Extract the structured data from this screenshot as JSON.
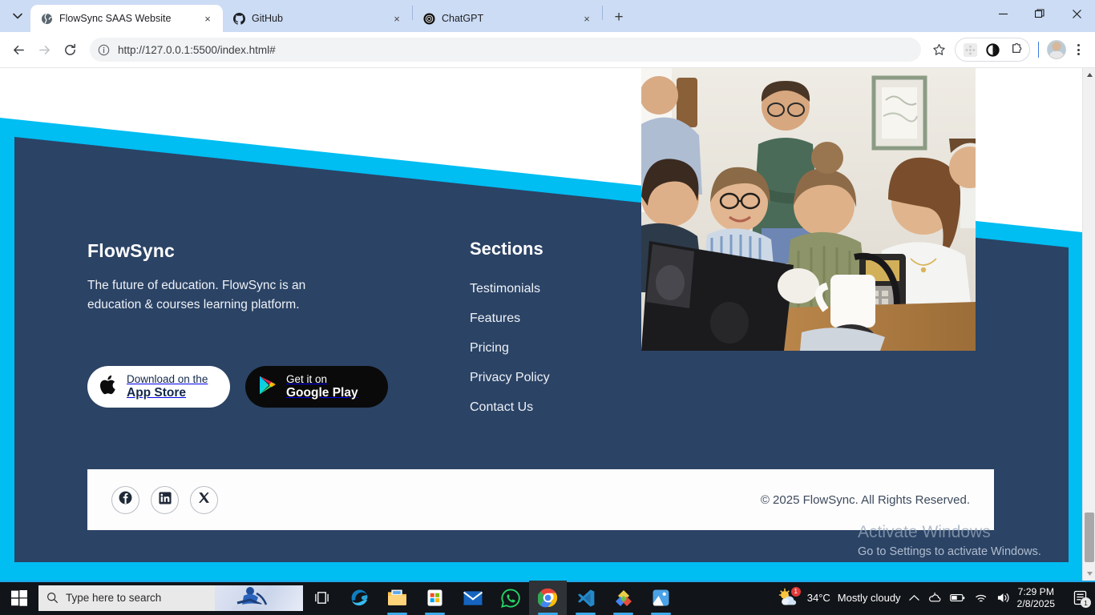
{
  "browser": {
    "tabs": [
      {
        "title": "FlowSync SAAS Website",
        "favicon": "globe-icon",
        "active": true,
        "close": "×"
      },
      {
        "title": "GitHub",
        "favicon": "github-icon",
        "active": false,
        "close": "×"
      },
      {
        "title": "ChatGPT",
        "favicon": "openai-icon",
        "active": false,
        "close": "×"
      }
    ],
    "new_tab_label": "+",
    "window_controls": {
      "minimize": "—",
      "maximize": "❐",
      "close": "✕"
    },
    "toolbar": {
      "back": "←",
      "forward": "→",
      "reload": "↻",
      "url": "http://127.0.0.1:5500/index.html#",
      "site_info": "info-icon",
      "bookmark": "star-icon",
      "extensions": "puzzle-icon",
      "profile": "avatar",
      "menu": "kebab-menu-icon"
    }
  },
  "page": {
    "brand": "FlowSync",
    "tagline": "The future of education. FlowSync is an education & courses learning platform.",
    "store_buttons": [
      {
        "id": "app-store",
        "icon": "apple-icon",
        "top": "Download on the",
        "bottom": "App Store"
      },
      {
        "id": "google-play",
        "icon": "google-play-icon",
        "top": "Get it on",
        "bottom": "Google Play"
      }
    ],
    "sections": {
      "title": "Sections",
      "links": [
        "Testimonials",
        "Features",
        "Pricing",
        "Privacy Policy",
        "Contact Us"
      ]
    },
    "socials": [
      {
        "id": "facebook",
        "icon": "facebook-icon"
      },
      {
        "id": "linkedin",
        "icon": "linkedin-icon"
      },
      {
        "id": "x-twitter",
        "icon": "x-twitter-icon"
      }
    ],
    "copyright": "© 2025 FlowSync. All Rights Reserved.",
    "colors": {
      "navy": "#2b4365",
      "cyan": "#00bdf2",
      "white": "#ffffff",
      "dark": "#0a0a0a"
    }
  },
  "watermark": {
    "line1": "Activate Windows",
    "line2": "Go to Settings to activate Windows."
  },
  "taskbar": {
    "start": "windows-icon",
    "search_placeholder": "Type here to search",
    "apps": [
      {
        "id": "task-view",
        "icon": "task-view-icon"
      },
      {
        "id": "edge",
        "icon": "edge-icon"
      },
      {
        "id": "file-explorer",
        "icon": "folder-icon"
      },
      {
        "id": "microsoft-store",
        "icon": "store-icon"
      },
      {
        "id": "mail",
        "icon": "mail-icon"
      },
      {
        "id": "whatsapp",
        "icon": "whatsapp-icon"
      },
      {
        "id": "chrome",
        "icon": "chrome-icon"
      },
      {
        "id": "vscode",
        "icon": "vscode-icon"
      },
      {
        "id": "photoshop-ai",
        "icon": "diamond-icon"
      },
      {
        "id": "photos",
        "icon": "photos-icon"
      }
    ],
    "weather": {
      "temp": "34°C",
      "condition": "Mostly cloudy",
      "icon": "sun-cloud-icon",
      "badge": "1"
    },
    "tray": [
      "chevron-up-icon",
      "onedrive-icon",
      "battery-icon",
      "wifi-icon",
      "volume-icon"
    ],
    "clock": {
      "time": "7:29 PM",
      "date": "2/8/2025"
    },
    "notification_badge": "1"
  }
}
